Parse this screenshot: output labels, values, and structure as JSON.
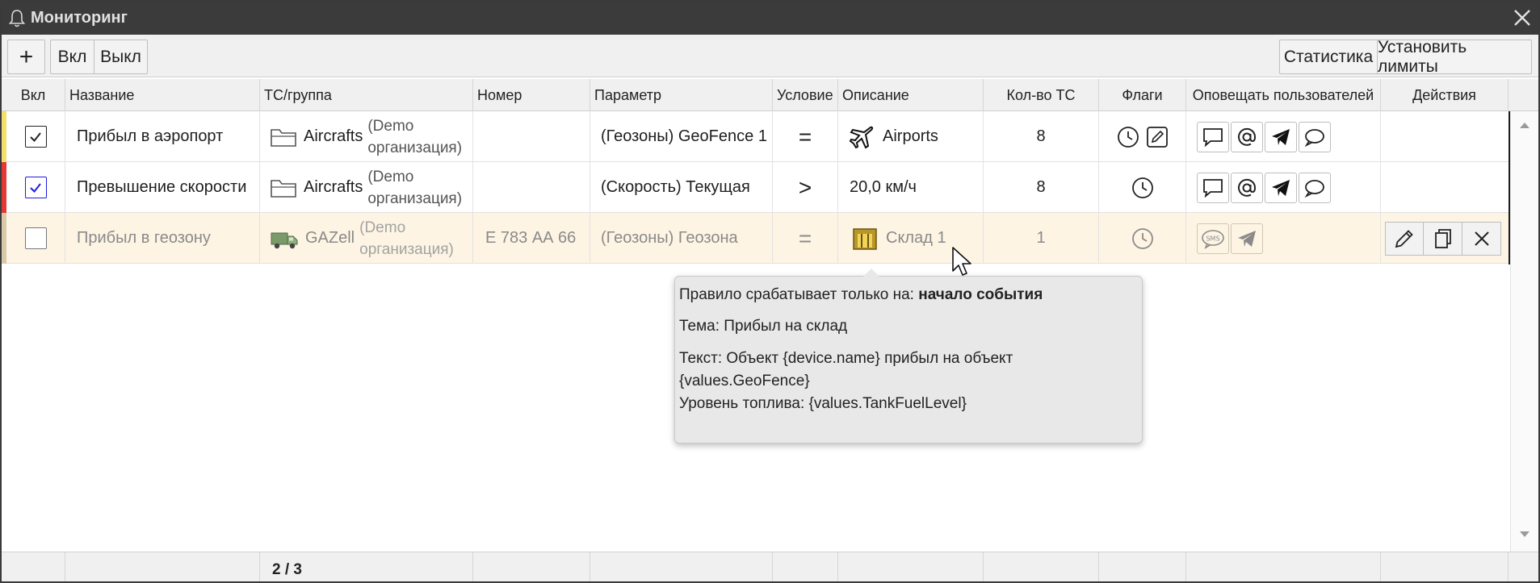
{
  "window": {
    "title": "Мониторинг"
  },
  "toolbar": {
    "add_label": "+",
    "on_label": "Вкл",
    "off_label": "Выкл",
    "stats_label": "Статистика",
    "limits_label": "Установить лимиты"
  },
  "columns": [
    "Вкл",
    "Название",
    "ТС/группа",
    "Номер",
    "Параметр",
    "Условие",
    "Описание",
    "Кол-во ТС",
    "Флаги",
    "Оповещать пользователей",
    "Действия"
  ],
  "rows": [
    {
      "stripe_color": "#f2df6b",
      "enabled": true,
      "name": "Прибыл в аэропорт",
      "group_icon": "folder-icon",
      "group": "Aircrafts",
      "org": "(Demo организация)",
      "number": "",
      "parameter": "(Геозоны) GeoFence 1",
      "condition": "=",
      "desc_icon": "airplane-icon",
      "description": "Airports",
      "count": "8",
      "flags": [
        "clock-icon",
        "edit-note-icon"
      ],
      "notify": [
        "message-icon",
        "email-icon",
        "telegram-icon",
        "chat-icon"
      ]
    },
    {
      "stripe_color": "#e53935",
      "enabled": true,
      "name": "Превышение скорости",
      "group_icon": "folder-icon",
      "group": "Aircrafts",
      "org": "(Demo организация)",
      "number": "",
      "parameter": "(Скорость) Текущая",
      "condition": ">",
      "desc_icon": "",
      "description": "20,0 км/ч",
      "count": "8",
      "flags": [
        "clock-icon"
      ],
      "notify": [
        "message-icon",
        "email-icon",
        "telegram-icon",
        "chat-icon"
      ]
    },
    {
      "stripe_color": "#d9c9a9",
      "enabled": false,
      "name": "Прибыл в геозону",
      "group_icon": "truck-icon",
      "group": "GAZell",
      "org": "(Demo организация)",
      "number": "Е 783 АА 66",
      "parameter": "(Геозоны) Геозона",
      "condition": "=",
      "desc_icon": "warehouse-icon",
      "description": "Склад 1",
      "count": "1",
      "flags": [
        "clock-icon"
      ],
      "notify": [
        "sms-icon",
        "telegram-icon"
      ],
      "actions": [
        "edit-icon",
        "copy-icon",
        "delete-icon"
      ]
    }
  ],
  "tooltip": {
    "line1_prefix": "Правило срабатывает только на:",
    "line1_value": "начало события",
    "subject": "Тема: Прибыл на склад",
    "text_line1": "Текст: Объект {device.name} прибыл на объект {values.GeoFence}",
    "text_line2": "Уровень топлива: {values.TankFuelLevel}"
  },
  "footer": {
    "count": "2 / 3"
  },
  "colors": {
    "titlebar": "#3b3b3b",
    "row_highlight": "#fdf4e4",
    "checkbox_blue": "#1d1de0"
  }
}
